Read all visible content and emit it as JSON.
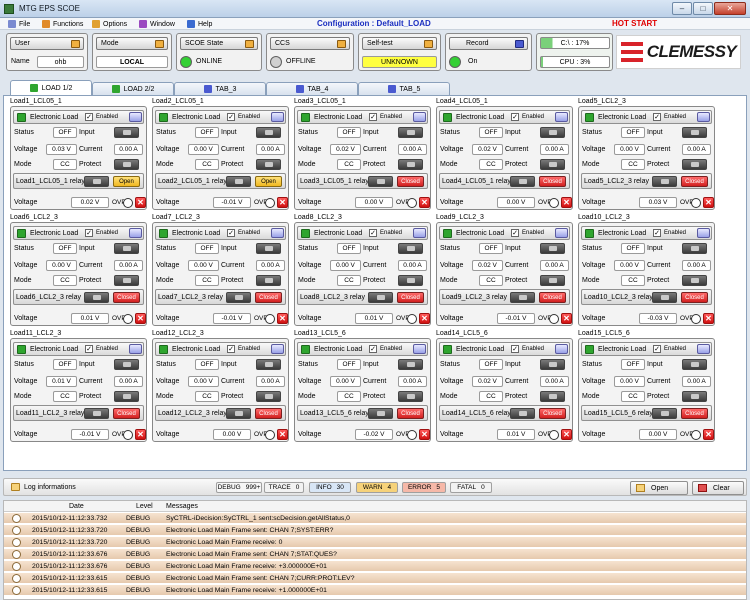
{
  "app": {
    "title": "MTG EPS SCOE",
    "config": "Configuration : Default_LOAD",
    "hot_start": "HOT START"
  },
  "window_buttons": [
    "–",
    "□",
    "✕"
  ],
  "menu": [
    {
      "label": "File",
      "icon": "file-icon",
      "color": "#7a8ad0"
    },
    {
      "label": "Functions",
      "icon": "functions-icon",
      "color": "#e08a2a"
    },
    {
      "label": "Options",
      "icon": "options-icon",
      "color": "#e0a030"
    },
    {
      "label": "Window",
      "icon": "window-icon",
      "color": "#9a4ac0"
    },
    {
      "label": "Help",
      "icon": "help-icon",
      "color": "#3a6ad0"
    }
  ],
  "toolbar": {
    "user_label": "User",
    "name_label": "Name",
    "name_value": "ohb",
    "mode_label": "Mode",
    "mode_value": "LOCAL",
    "scoe_label": "SCOE State",
    "scoe_value": "ONLINE",
    "ccs_label": "CCS",
    "ccs_value": "OFFLINE",
    "selftest_label": "Self-test",
    "selftest_value": "UNKNOWN",
    "record_label": "Record",
    "record_value": "On",
    "disk_value": "C:\\ : 17%",
    "cpu_value": "CPU : 3%",
    "logo_text": "CLEMESSY",
    "colors": {
      "online": "#35d035",
      "offline": "#d0d0d0",
      "unknown": "#ffff40",
      "record_on": "#35d035"
    }
  },
  "tabs": [
    {
      "label": "LOAD 1/2",
      "active": true,
      "icon_color": "#2fa52f"
    },
    {
      "label": "LOAD 2/2",
      "active": false,
      "icon_color": "#2fa52f"
    },
    {
      "label": "TAB_3",
      "active": false,
      "icon_color": "#4a5ad0"
    },
    {
      "label": "TAB_4",
      "active": false,
      "icon_color": "#4a5ad0"
    },
    {
      "label": "TAB_5",
      "active": false,
      "icon_color": "#4a5ad0"
    }
  ],
  "unit_labels": {
    "header": "Electronic Load",
    "enabled": "Enabled",
    "status": "Status",
    "input": "Input",
    "voltage": "Voltage",
    "current": "Current",
    "mode": "Mode",
    "protect": "Protect",
    "ovp": "OVP",
    "status_value": "OFF",
    "mode_value": "CC",
    "checkmark": "✓",
    "close": "✕"
  },
  "units": [
    {
      "name": "Load1_LCL05_1",
      "voltage": "0.03 V",
      "current": "0.00 A",
      "relay": "Load1_LCL05_1 relay",
      "relay_state": "Open",
      "bottom_voltage": "0.02 V"
    },
    {
      "name": "Load2_LCL05_1",
      "voltage": "0.00 V",
      "current": "0.00 A",
      "relay": "Load2_LCL05_1 relay",
      "relay_state": "Open",
      "bottom_voltage": "-0.01 V"
    },
    {
      "name": "Load3_LCL05_1",
      "voltage": "0.02 V",
      "current": "0.00 A",
      "relay": "Load3_LCL05_1 relay",
      "relay_state": "Closed",
      "bottom_voltage": "0.00 V"
    },
    {
      "name": "Load4_LCL05_1",
      "voltage": "0.02 V",
      "current": "0.00 A",
      "relay": "Load4_LCL05_1 relay",
      "relay_state": "Closed",
      "bottom_voltage": "0.00 V"
    },
    {
      "name": "Load5_LCL2_3",
      "voltage": "0.00 V",
      "current": "0.00 A",
      "relay": "Load5_LCL2_3 relay",
      "relay_state": "Closed",
      "bottom_voltage": "0.03 V"
    },
    {
      "name": "Load6_LCL2_3",
      "voltage": "0.00 V",
      "current": "0.00 A",
      "relay": "Load6_LCL2_3 relay",
      "relay_state": "Closed",
      "bottom_voltage": "0.01 V"
    },
    {
      "name": "Load7_LCL2_3",
      "voltage": "0.00 V",
      "current": "0.00 A",
      "relay": "Load7_LCL2_3 relay",
      "relay_state": "Closed",
      "bottom_voltage": "-0.01 V"
    },
    {
      "name": "Load8_LCL2_3",
      "voltage": "0.00 V",
      "current": "0.00 A",
      "relay": "Load8_LCL2_3 relay",
      "relay_state": "Closed",
      "bottom_voltage": "0.01 V"
    },
    {
      "name": "Load9_LCL2_3",
      "voltage": "0.02 V",
      "current": "0.00 A",
      "relay": "Load9_LCL2_3 relay",
      "relay_state": "Closed",
      "bottom_voltage": "-0.01 V"
    },
    {
      "name": "Load10_LCL2_3",
      "voltage": "0.00 V",
      "current": "0.00 A",
      "relay": "Load10_LCL2_3 relay",
      "relay_state": "Closed",
      "bottom_voltage": "-0.03 V"
    },
    {
      "name": "Load11_LCL2_3",
      "voltage": "0.01 V",
      "current": "0.00 A",
      "relay": "Load11_LCL2_3 relay",
      "relay_state": "Closed",
      "bottom_voltage": "-0.01 V"
    },
    {
      "name": "Load12_LCL2_3",
      "voltage": "0.00 V",
      "current": "0.00 A",
      "relay": "Load12_LCL2_3 relay",
      "relay_state": "Closed",
      "bottom_voltage": "0.00 V"
    },
    {
      "name": "Load13_LCL5_6",
      "voltage": "0.00 V",
      "current": "0.00 A",
      "relay": "Load13_LCL5_6 relay",
      "relay_state": "Closed",
      "bottom_voltage": "-0.02 V"
    },
    {
      "name": "Load14_LCL5_6",
      "voltage": "0.02 V",
      "current": "0.00 A",
      "relay": "Load14_LCL5_6 relay",
      "relay_state": "Closed",
      "bottom_voltage": "0.01 V"
    },
    {
      "name": "Load15_LCL5_6",
      "voltage": "0.00 V",
      "current": "0.00 A",
      "relay": "Load15_LCL5_6 relay",
      "relay_state": "Closed",
      "bottom_voltage": "0.00 V"
    }
  ],
  "log": {
    "title": "Log informations",
    "levels": [
      {
        "label": "DEBUG",
        "count": "999+",
        "color": "#f6f6f6"
      },
      {
        "label": "TRACE",
        "count": "0",
        "color": "#f2f2f2"
      },
      {
        "label": "INFO",
        "count": "30",
        "color": "#d8e6f6"
      },
      {
        "label": "WARN",
        "count": "4",
        "color": "#f6d27a"
      },
      {
        "label": "ERROR",
        "count": "5",
        "color": "#f6b8a8"
      },
      {
        "label": "FATAL",
        "count": "0",
        "color": "#f2f2f2"
      }
    ],
    "open_label": "Open",
    "clear_label": "Clear",
    "columns": {
      "date": "Date",
      "level": "Level",
      "messages": "Messages"
    },
    "rows": [
      {
        "date": "2015/10/12-11:12:33.732",
        "level": "DEBUG",
        "message": "SyCTRL-iDecision:SyCTRL_1 sent:scDecision.getAllStatus,0"
      },
      {
        "date": "2015/10/12-11:12:33.720",
        "level": "DEBUG",
        "message": "Electronic Load Main Frame sent: CHAN 7;SYST:ERR?"
      },
      {
        "date": "2015/10/12-11:12:33.720",
        "level": "DEBUG",
        "message": "Electronic Load Main Frame receive: 0"
      },
      {
        "date": "2015/10/12-11:12:33.676",
        "level": "DEBUG",
        "message": "Electronic Load Main Frame sent: CHAN 7;STAT:QUES?"
      },
      {
        "date": "2015/10/12-11:12:33.676",
        "level": "DEBUG",
        "message": "Electronic Load Main Frame receive: +3.000000E+01"
      },
      {
        "date": "2015/10/12-11:12:33.615",
        "level": "DEBUG",
        "message": "Electronic Load Main Frame sent: CHAN 7;CURR:PROT:LEV?"
      },
      {
        "date": "2015/10/12-11:12:33.615",
        "level": "DEBUG",
        "message": "Electronic Load Main Frame receive: +1.000000E+01"
      }
    ]
  }
}
